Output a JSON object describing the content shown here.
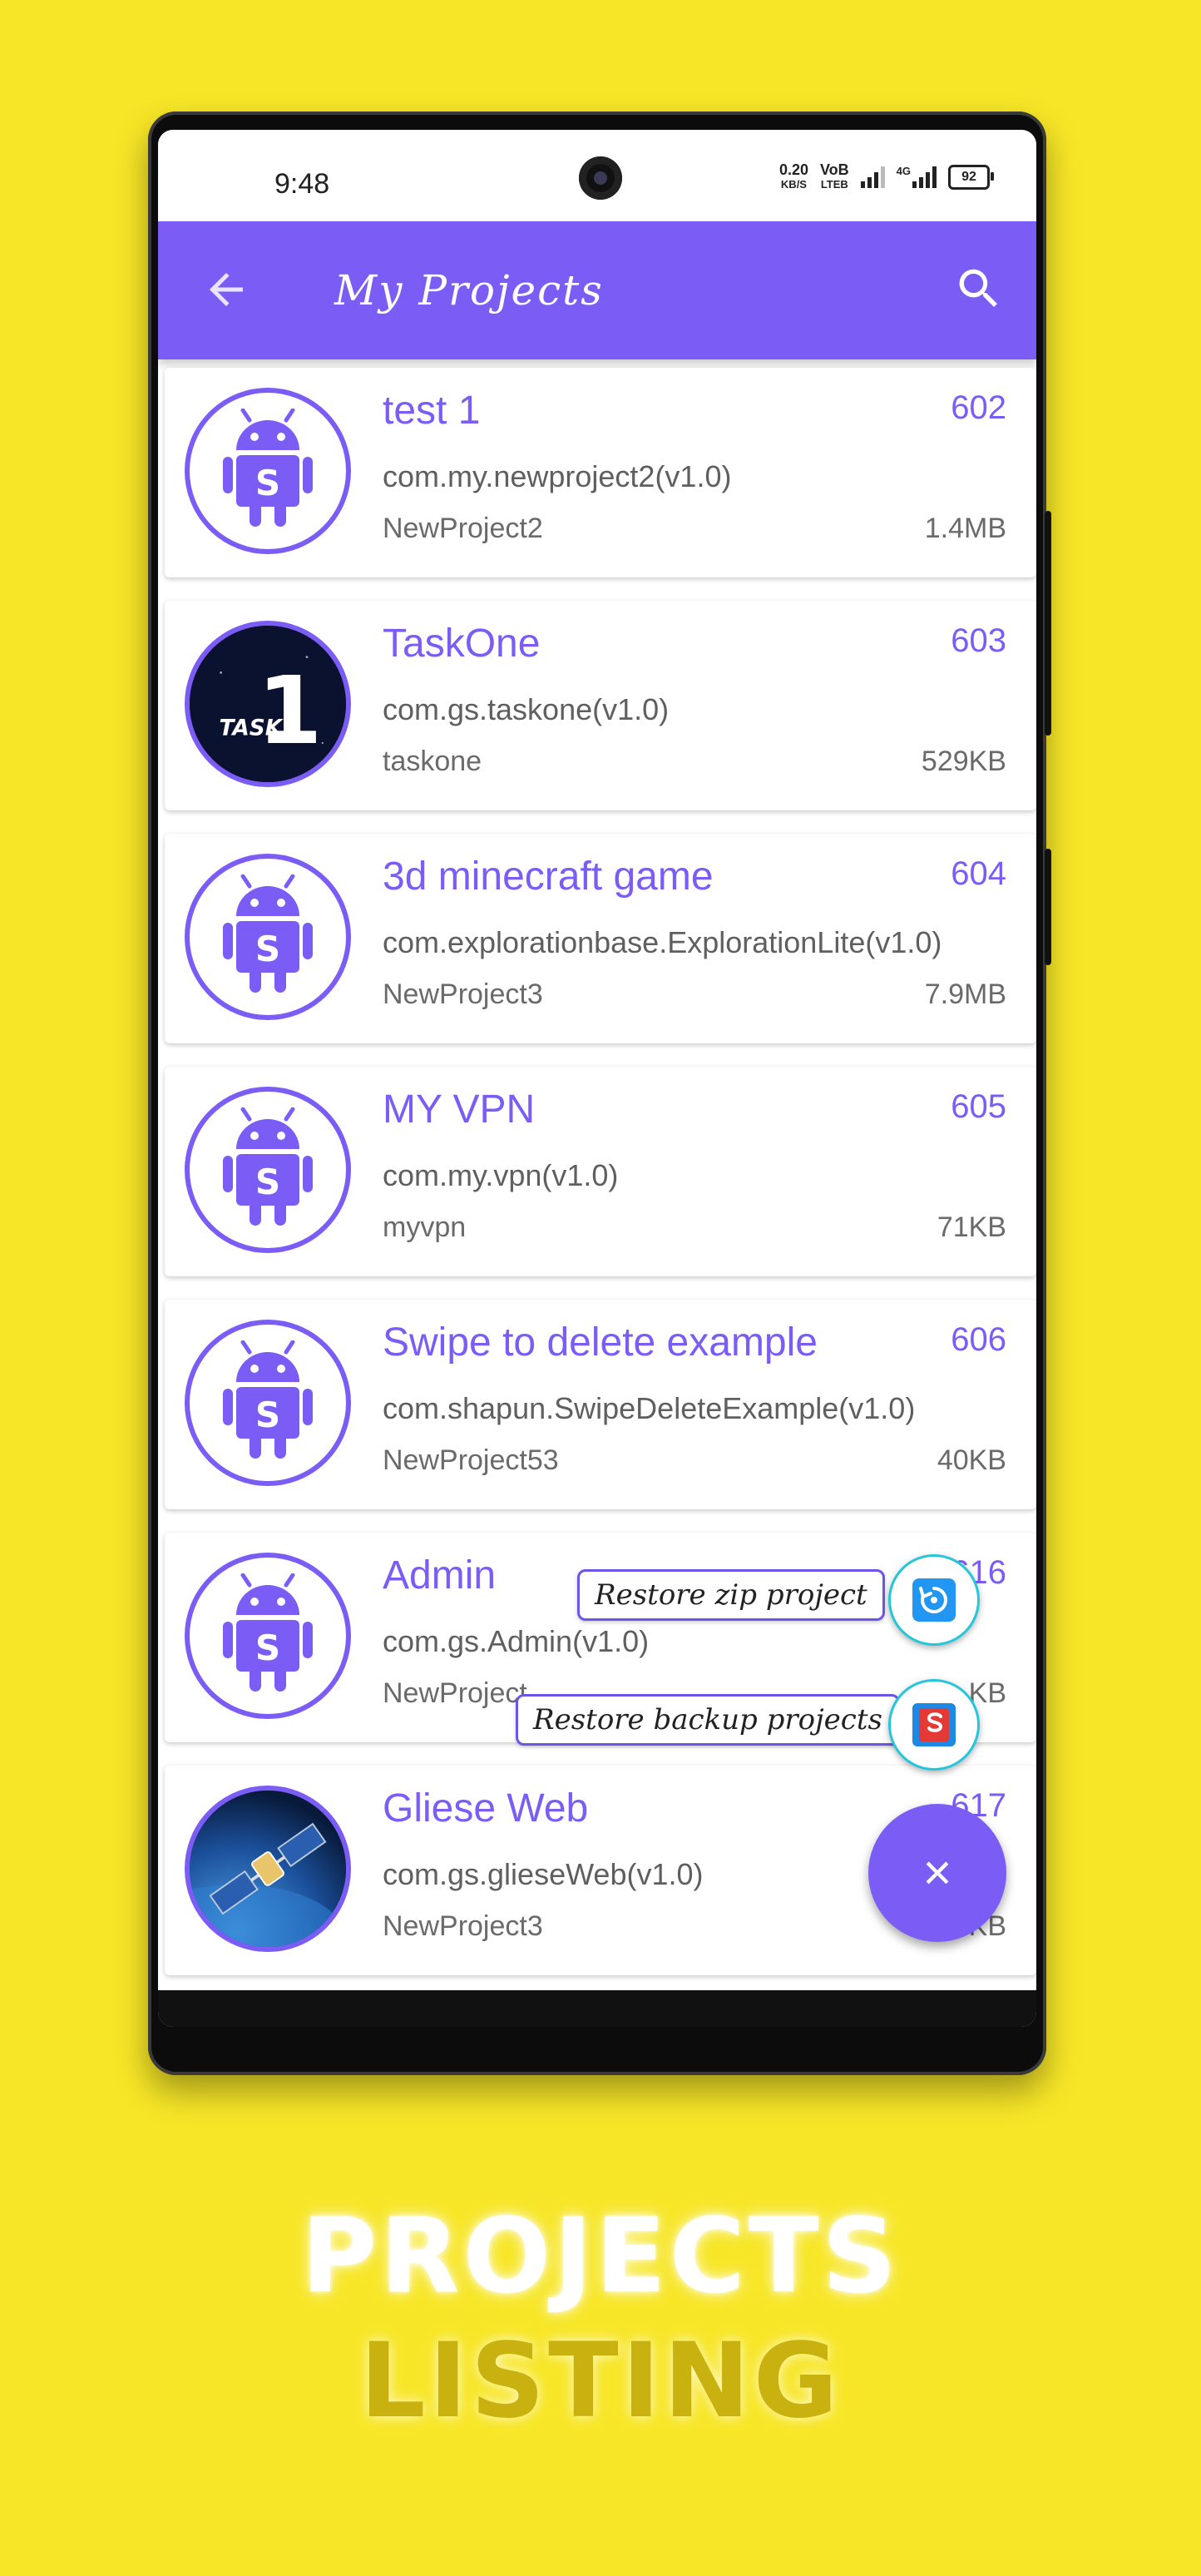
{
  "status_bar": {
    "time": "9:48",
    "net_speed_value": "0.20",
    "net_speed_unit": "KB/S",
    "volte_top": "VoB",
    "volte_bottom": "LTEB",
    "network": "4G",
    "battery": "92"
  },
  "app_bar": {
    "title": "My Projects",
    "back_icon": "arrow-left-icon",
    "search_icon": "search-icon"
  },
  "projects": [
    {
      "name": "test 1",
      "id": "602",
      "package": "com.my.newproject2(v1.0)",
      "project": "NewProject2",
      "size": "1.4MB",
      "icon": "android-sketchware-icon"
    },
    {
      "name": "TaskOne",
      "id": "603",
      "package": "com.gs.taskone(v1.0)",
      "project": "taskone",
      "size": "529KB",
      "icon": "task-1-icon",
      "icon_text": "TASK",
      "icon_number": "1"
    },
    {
      "name": "3d minecraft game",
      "id": "604",
      "package": "com.explorationbase.ExplorationLite(v1.0)",
      "project": "NewProject3",
      "size": "7.9MB",
      "icon": "android-sketchware-icon"
    },
    {
      "name": "MY VPN",
      "id": "605",
      "package": "com.my.vpn(v1.0)",
      "project": "myvpn",
      "size": "71KB",
      "icon": "android-sketchware-icon"
    },
    {
      "name": "Swipe to delete example",
      "id": "606",
      "package": "com.shapun.SwipeDeleteExample(v1.0)",
      "project": "NewProject53",
      "size": "40KB",
      "icon": "android-sketchware-icon"
    },
    {
      "name": "Admin",
      "id": "616",
      "package": "com.gs.Admin(v1.0)",
      "project": "NewProject",
      "size": "KB",
      "icon": "android-sketchware-icon"
    },
    {
      "name": "Gliese Web",
      "id": "617",
      "package": "com.gs.glieseWeb(v1.0)",
      "project": "NewProject3",
      "size": "KB",
      "icon": "satellite-icon"
    }
  ],
  "fab_menu": {
    "restore_zip_label": "Restore zip project",
    "restore_backup_label": "Restore backup projects",
    "close_symbol": "×"
  },
  "caption": {
    "line1": "PROJECTS",
    "line2": "LISTING"
  },
  "colors": {
    "background": "#F7E627",
    "accent": "#7B5CF5",
    "caption_line2": "#C9B20F"
  }
}
